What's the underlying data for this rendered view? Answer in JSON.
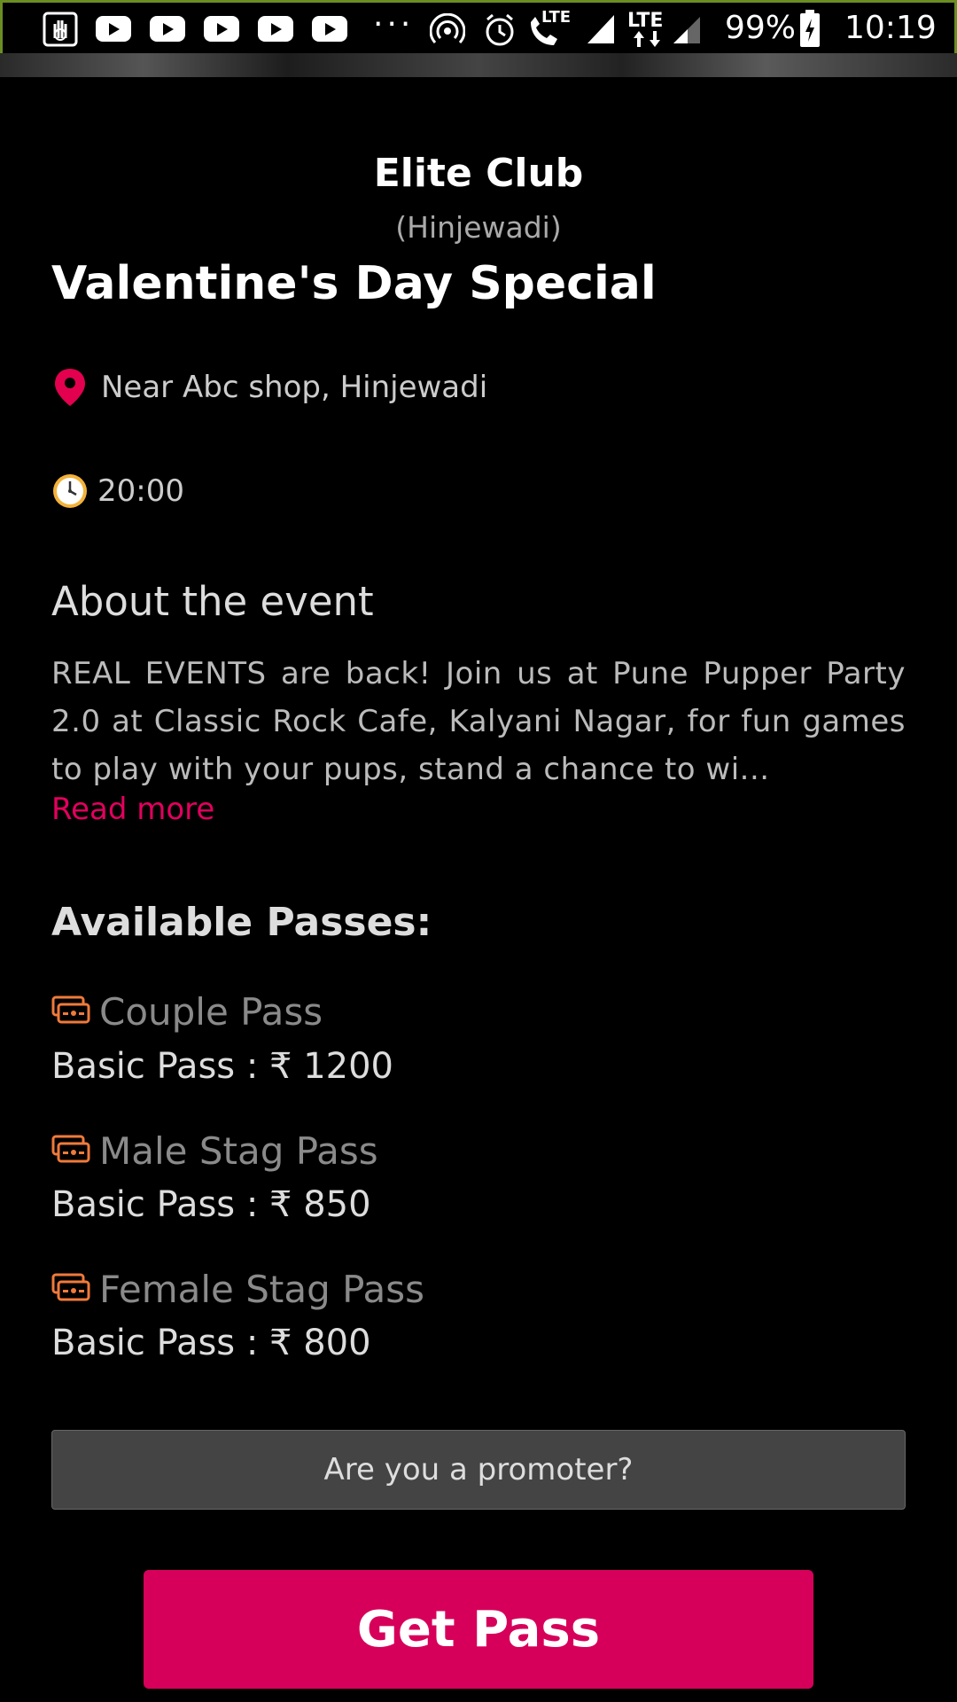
{
  "status_bar": {
    "battery": "99%",
    "time": "10:19",
    "network_1": "LTE",
    "network_2": "LTE"
  },
  "event": {
    "club_name": "Elite Club",
    "club_area": "(Hinjewadi)",
    "title": "Valentine's Day Special",
    "location": "Near Abc shop, Hinjewadi",
    "time": "20:00"
  },
  "about": {
    "heading": "About the event",
    "body": "REAL EVENTS are back! Join us at Pune Pupper Party 2.0 at Classic Rock Cafe, Kalyani Nagar, for fun games to play with your pups, stand a chance to wi...",
    "read_more": "Read more"
  },
  "passes": {
    "heading": "Available Passes:",
    "items": [
      {
        "name": "Couple Pass",
        "price": "Basic Pass : ₹ 1200"
      },
      {
        "name": "Male Stag Pass",
        "price": "Basic Pass : ₹ 850"
      },
      {
        "name": "Female Stag Pass",
        "price": "Basic Pass : ₹ 800"
      }
    ]
  },
  "actions": {
    "promoter": "Are you a promoter?",
    "get_pass": "Get Pass"
  },
  "colors": {
    "accent": "#d6005a",
    "pass_icon": "#f07a3a",
    "location_pin": "#e3004f"
  }
}
